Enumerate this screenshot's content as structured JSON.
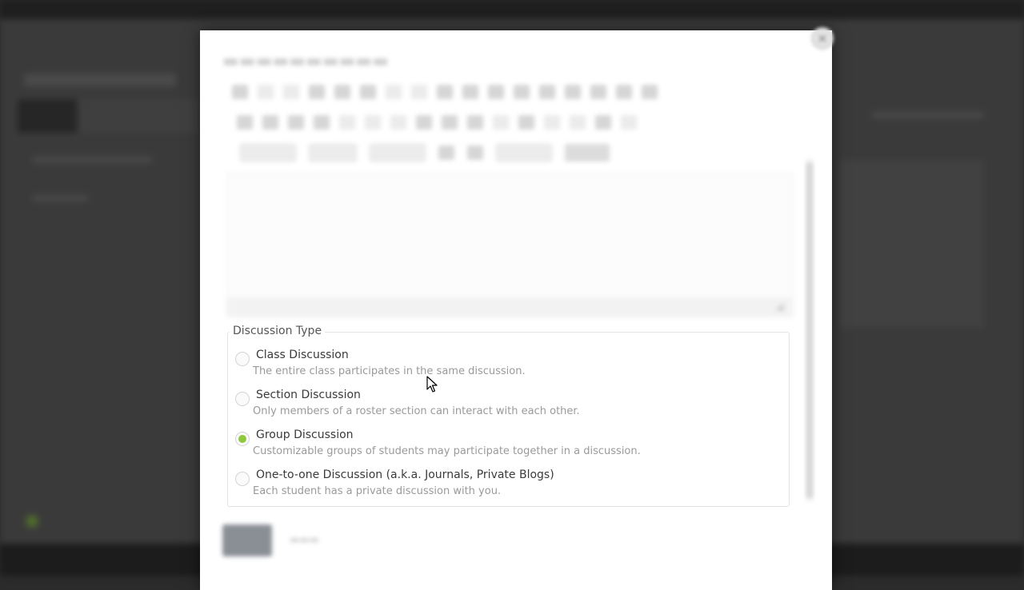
{
  "discussion_type": {
    "legend": "Discussion Type",
    "options": [
      {
        "title": "Class Discussion",
        "description": "The entire class participates in the same discussion.",
        "checked": false
      },
      {
        "title": "Section Discussion",
        "description": "Only members of a roster section can interact with each other.",
        "checked": false
      },
      {
        "title": "Group Discussion",
        "description": "Customizable groups of students may participate together in a discussion.",
        "checked": true
      },
      {
        "title": "One-to-one Discussion (a.k.a. Journals, Private Blogs)",
        "description": "Each student has a private discussion with you.",
        "checked": false
      }
    ]
  },
  "colors": {
    "radio_checked": "#8fc73e",
    "overlay_background": "#3a3a3a",
    "modal_background": "#ffffff"
  },
  "icons": {
    "close": "close-icon",
    "resize": "resize-grip-icon",
    "cursor": "mouse-pointer-icon"
  }
}
